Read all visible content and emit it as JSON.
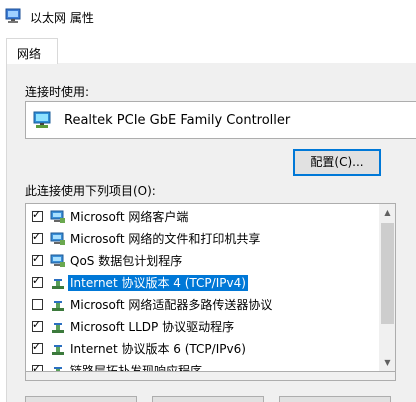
{
  "window": {
    "title": "以太网 属性",
    "icon": "network-adapter-icon"
  },
  "tabs": [
    {
      "label": "网络",
      "active": true
    }
  ],
  "connect_using": {
    "label": "连接时使用:",
    "adapter_name": "Realtek PCIe GbE Family Controller",
    "adapter_icon": "network-adapter-icon"
  },
  "buttons": {
    "configure": "配置(C)..."
  },
  "items_section": {
    "label": "此连接使用下列项目(O):",
    "items": [
      {
        "label": "Microsoft 网络客户端",
        "checked": true,
        "icon": "network-client-icon",
        "selected": false
      },
      {
        "label": "Microsoft 网络的文件和打印机共享",
        "checked": true,
        "icon": "network-service-icon",
        "selected": false
      },
      {
        "label": "QoS 数据包计划程序",
        "checked": true,
        "icon": "network-service-icon",
        "selected": false
      },
      {
        "label": "Internet 协议版本 4 (TCP/IPv4)",
        "checked": true,
        "icon": "protocol-icon",
        "selected": true
      },
      {
        "label": "Microsoft 网络适配器多路传送器协议",
        "checked": false,
        "icon": "protocol-icon",
        "selected": false
      },
      {
        "label": "Microsoft LLDP 协议驱动程序",
        "checked": true,
        "icon": "protocol-icon",
        "selected": false
      },
      {
        "label": "Internet 协议版本 6 (TCP/IPv6)",
        "checked": true,
        "icon": "protocol-icon",
        "selected": false
      },
      {
        "label": "链路层拓扑发现响应程序",
        "checked": true,
        "icon": "protocol-icon",
        "selected": false
      }
    ]
  },
  "colors": {
    "accent": "#0078d7",
    "panel_bg": "#f0f0f0",
    "border": "#adadad"
  }
}
